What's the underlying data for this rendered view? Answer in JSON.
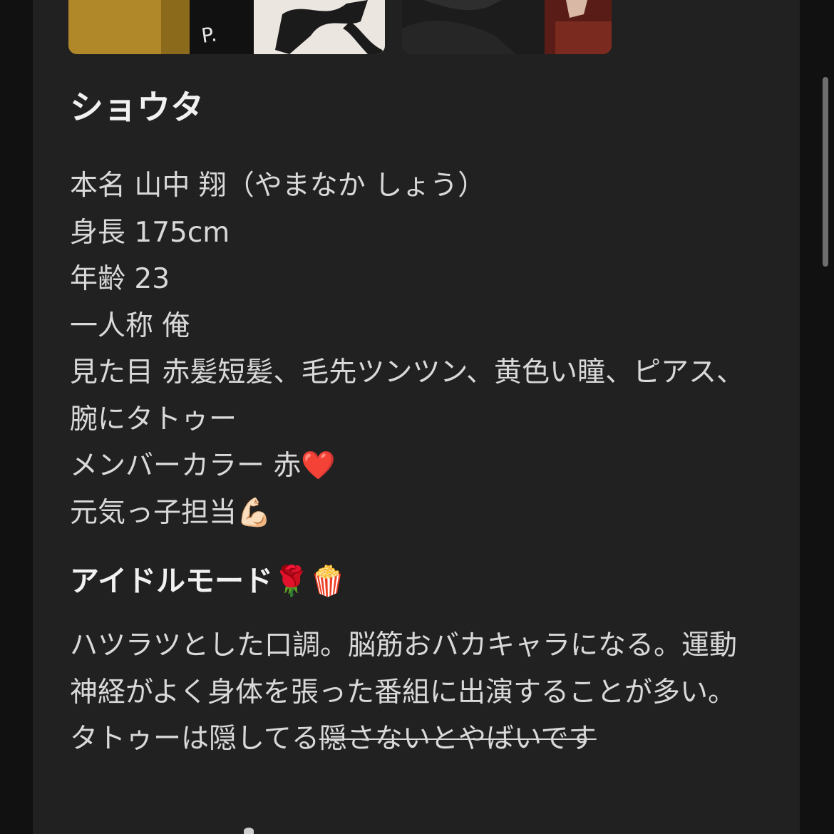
{
  "character": {
    "name": "ショウタ"
  },
  "profile": [
    "本名 山中 翔（やまなか しょう）",
    "身長 175cm",
    "年齢 23",
    "一人称 俺",
    "見た目 赤髪短髪、毛先ツンツン、黄色い瞳、ピアス、腕にタトゥー",
    "メンバーカラー 赤❤️",
    "元気っ子担当💪🏻"
  ],
  "idol_mode": {
    "title": "アイドルモード🌹🍿",
    "body_plain": "ハツラツとした口調。脳筋おバカキャラになる。運動神経がよく身体を張った番組に出演することが多い。タトゥーは隠してる",
    "body_struck": "隠さないとやばいです"
  },
  "images": [
    {
      "icon": "character-illustration-1"
    },
    {
      "icon": "character-illustration-2"
    }
  ],
  "colors": {
    "background": "#111111",
    "card": "#212121",
    "text": "#d9d9d9",
    "heading": "#f1f1f1"
  }
}
